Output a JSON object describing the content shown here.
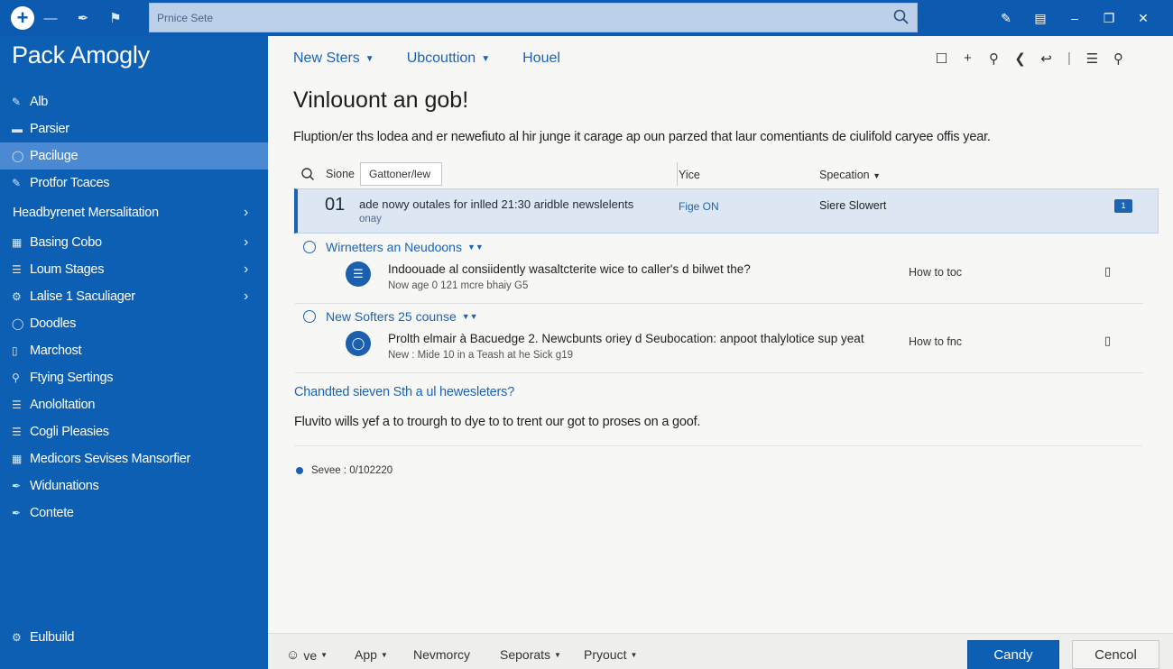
{
  "colors": {
    "brand": "#0d5fb4",
    "accent": "#1d63b5",
    "selected_row": "#dde7f3",
    "sidebar_active": "#4b8ad2"
  },
  "topbar": {
    "search_placeholder": "Prnice Sete",
    "left_icons": [
      "add-icon",
      "minus-icon",
      "pen-icon",
      "flag-icon"
    ],
    "right_icons": [
      "edit-icon",
      "note-icon",
      "minimize-icon",
      "restore-icon",
      "close-icon"
    ]
  },
  "sidebar": {
    "title": "Pack Amogly",
    "items": [
      {
        "label": "Alb",
        "icon": "edit-icon"
      },
      {
        "label": "Parsier",
        "icon": "bars-icon"
      },
      {
        "label": "Paciluge",
        "icon": "circle-icon",
        "active": true
      },
      {
        "label": "Protfor Tcaces",
        "icon": "edit-icon"
      },
      {
        "label": "Headbyrenet Mersalitation",
        "chevron": true
      },
      {
        "label": "Basing Cobo",
        "icon": "grid-icon",
        "chevron": true
      },
      {
        "label": "Loum Stages",
        "icon": "list-icon",
        "chevron": true
      },
      {
        "label": "Lalise 1 Saculiager",
        "icon": "gear-icon",
        "chevron": true
      },
      {
        "label": "Doodles",
        "icon": "circle-icon"
      },
      {
        "label": "Marchost",
        "icon": "doc-icon"
      },
      {
        "label": "Ftying Sertings",
        "icon": "key-icon"
      },
      {
        "label": "Anololtation",
        "icon": "list-icon"
      },
      {
        "label": "Cogli Pleasies",
        "icon": "list-icon"
      },
      {
        "label": "Medicors Sevises Mansorfier",
        "icon": "grid-icon"
      },
      {
        "label": "Widunations",
        "icon": "pen-icon"
      },
      {
        "label": "Contete",
        "icon": "pen-icon"
      }
    ],
    "bottom_item": {
      "label": "Eulbuild",
      "icon": "gear-icon"
    }
  },
  "main": {
    "tabs": [
      {
        "label": "New Sters",
        "dropdown": true
      },
      {
        "label": "Ubcouttion",
        "dropdown": true
      },
      {
        "label": "Houel",
        "dropdown": false
      }
    ],
    "title": "Vinlouont an gob!",
    "description": "Fluption/er ths lodea and er newefiuto al hir junge it carage ap oun parzed that laur comentiants de ciulifold caryee offis year.",
    "table_header": {
      "col1_label": "Sione",
      "filter_value": "Gattoner/lew",
      "col2_label": "Yice",
      "col3_label": "Specation"
    },
    "selected_row": {
      "number": "01",
      "title": "ade nowy outales for inlled 21:30 aridble newslelents",
      "subtitle": "onay",
      "status": "Fige ON",
      "owner": "Siere Slowert",
      "badge": "1"
    },
    "groups": [
      {
        "label": "Wirnetters an Neudoons",
        "item": {
          "title": "Indoouade al consiidently wasaltcterite wice to caller's d bilwet the?",
          "subtitle": "Now age 0 121 mcre bhaiy G5",
          "col2": "How to toc",
          "icon": "list-icon"
        }
      },
      {
        "label": "New Softers 25 counse",
        "item": {
          "title": "Prolth elmair à Bacuedge 2. Newcbunts oriey d Seubocation: anpoot thalylotice sup yeat",
          "subtitle": "New : Mide 10 in a Teash at he Sick g19",
          "col2": "How to fnc",
          "icon": "bulb-icon"
        }
      }
    ],
    "question_link": "Chandted sieven Sth a ul hewesleters?",
    "body_text": "Fluvito wills yef a to trourgh to dye to to trent our got to proses on a goof.",
    "status": "Sevee : 0/102220"
  },
  "footer": {
    "items": [
      {
        "label": "ve",
        "dropdown": true,
        "icon": "chat-icon"
      },
      {
        "label": "App",
        "dropdown": true
      },
      {
        "label": "Nevmorcy",
        "dropdown": false
      },
      {
        "label": "Seporats",
        "dropdown": true
      },
      {
        "label": "Pryouct",
        "dropdown": true
      }
    ],
    "primary_button": "Candy",
    "secondary_button": "Cencol"
  }
}
